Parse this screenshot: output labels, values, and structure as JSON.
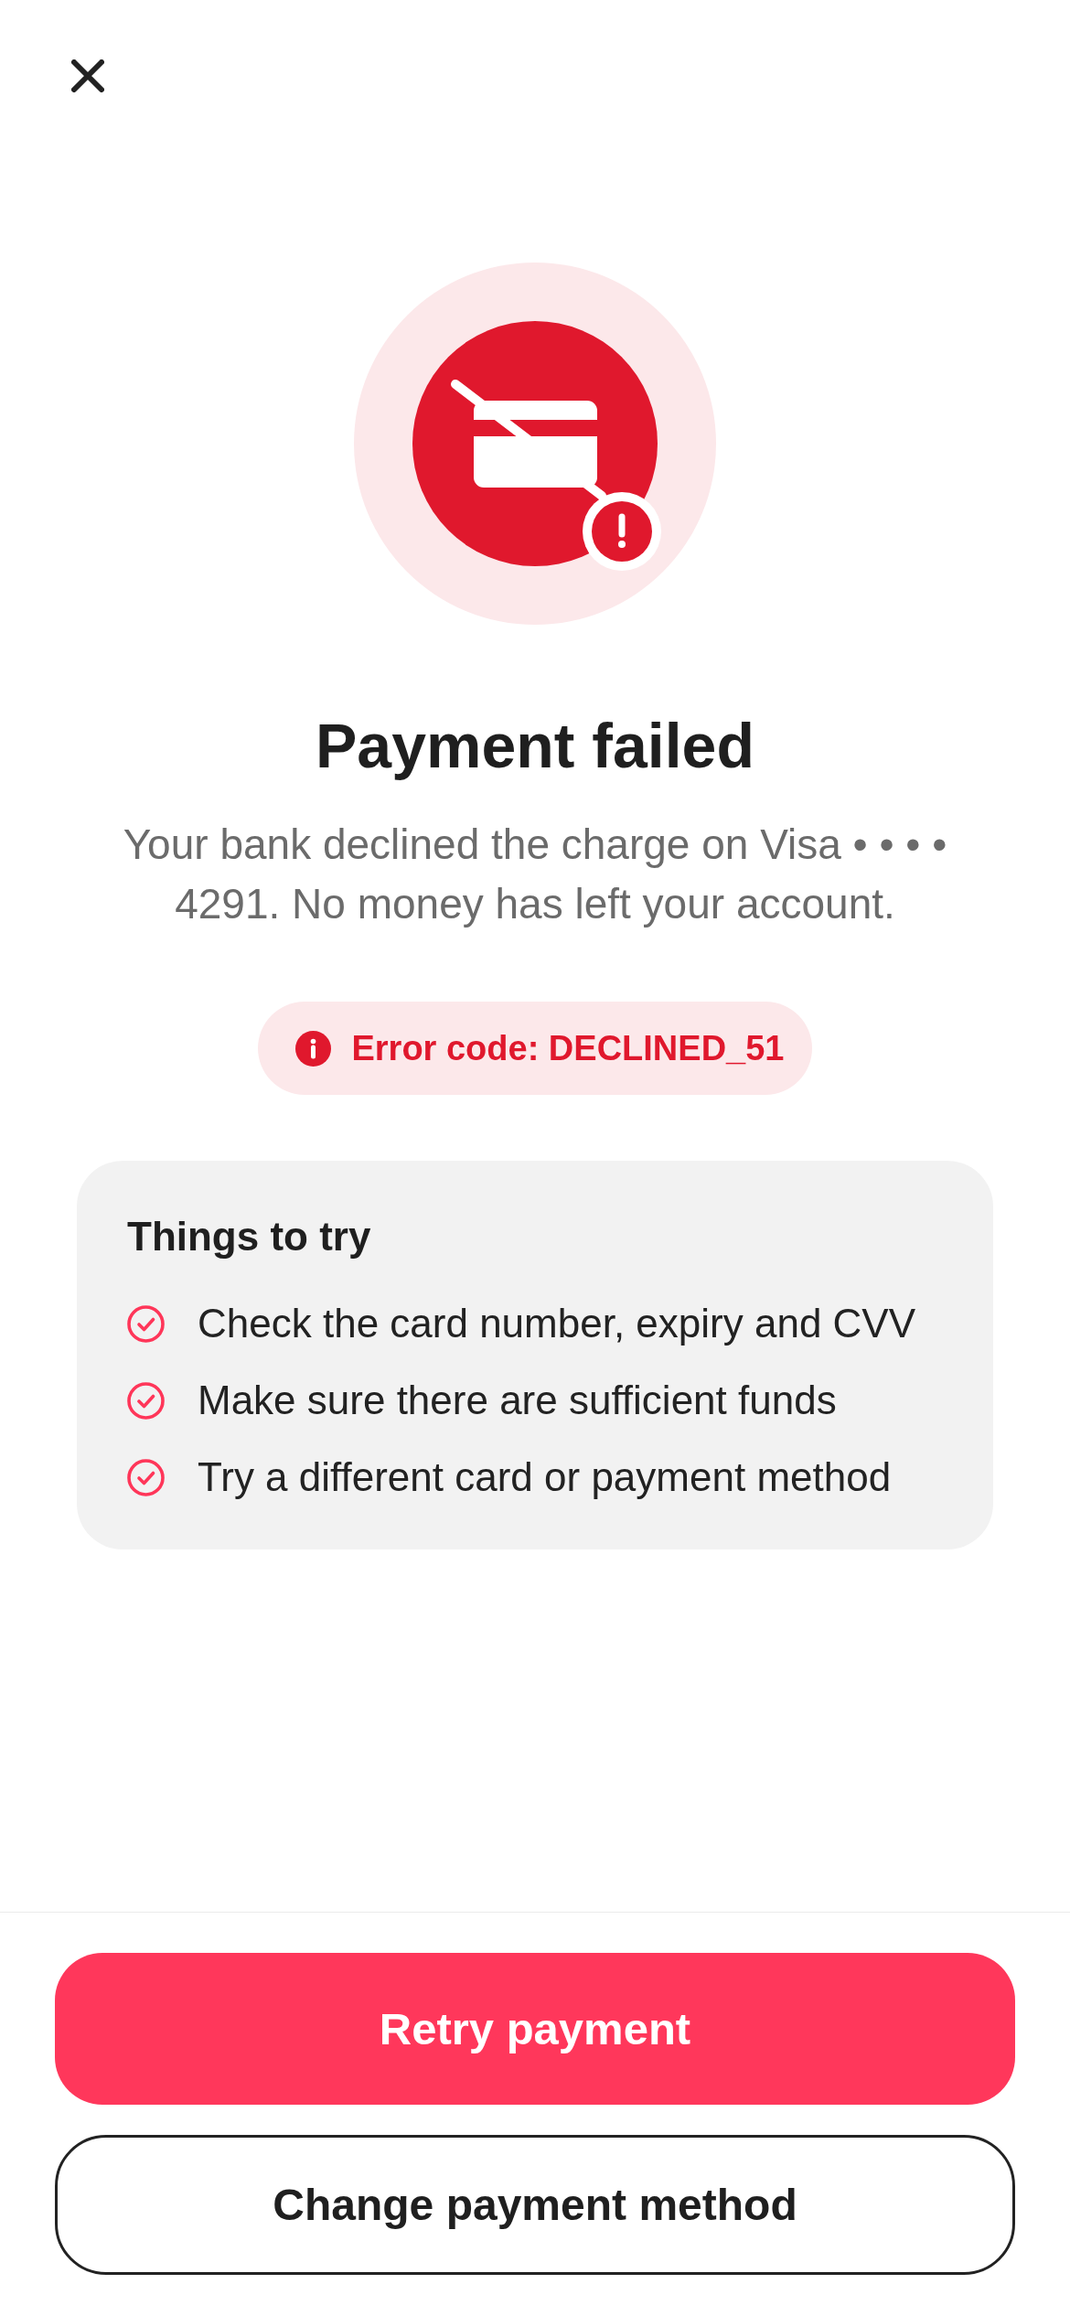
{
  "status": {
    "title": "Payment failed",
    "message": "Your bank declined the charge on Visa • • • • 4291. No money has left your account."
  },
  "error_badge": {
    "text": "Error code: DECLINED_51"
  },
  "tips": {
    "title": "Things to try",
    "items": [
      "Check the card number, expiry and CVV",
      "Make sure there are sufficient funds",
      "Try a different card or payment method"
    ]
  },
  "actions": [
    {
      "kind": "primary",
      "label": "Retry payment"
    },
    {
      "kind": "secondary",
      "label": "Change payment method"
    }
  ]
}
